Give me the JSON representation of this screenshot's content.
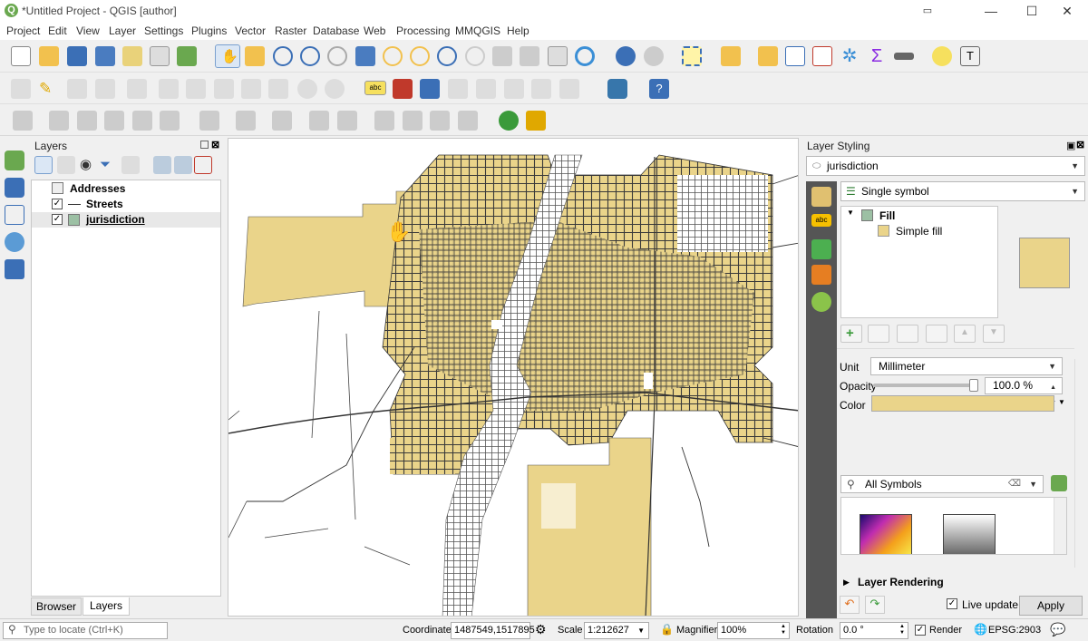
{
  "window": {
    "title": "*Untitled Project - QGIS [author]",
    "logo_letter": "Q",
    "min": "—",
    "max": "☐",
    "close": "✕"
  },
  "menu": [
    "Project",
    "Edit",
    "View",
    "Layer",
    "Settings",
    "Plugins",
    "Vector",
    "Raster",
    "Database",
    "Web",
    "Processing",
    "MMQGIS",
    "Help"
  ],
  "layers_panel": {
    "title": "Layers",
    "items": [
      {
        "name": "Addresses",
        "checked": false
      },
      {
        "name": "Streets",
        "checked": true
      },
      {
        "name": "jurisdiction",
        "checked": true
      }
    ],
    "tabs": [
      "Browser",
      "Layers"
    ]
  },
  "styling": {
    "title": "Layer Styling",
    "layer_select": "jurisdiction",
    "renderer": "Single symbol",
    "tree": {
      "root": "Fill",
      "child": "Simple fill"
    },
    "unit_label": "Unit",
    "unit_value": "Millimeter",
    "opacity_label": "Opacity",
    "opacity_value": "100.0 %",
    "color_label": "Color",
    "fill_color": "#ead48a",
    "symbols_search": "All Symbols",
    "layer_rendering": "Layer Rendering",
    "live_update": "Live update",
    "apply": "Apply"
  },
  "status": {
    "locate_placeholder": "Type to locate (Ctrl+K)",
    "coordinate_label": "Coordinate",
    "coordinate_value": "1487549,1517895",
    "scale_label": "Scale",
    "scale_value": "1:212627",
    "magnifier_label": "Magnifier",
    "magnifier_value": "100%",
    "rotation_label": "Rotation",
    "rotation_value": "0.0 °",
    "render_label": "Render",
    "crs": "EPSG:2903"
  },
  "colors": {
    "accent_green": "#6aa84f",
    "map_fill": "#ead48a",
    "street": "#3a3a3a"
  }
}
